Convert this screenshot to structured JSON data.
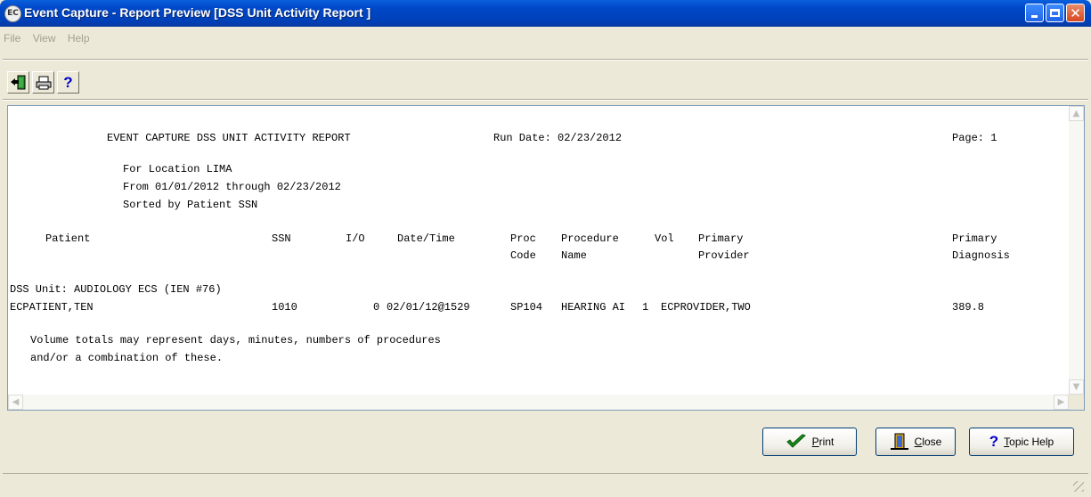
{
  "window": {
    "title": "Event Capture - Report Preview [DSS Unit Activity Report ]",
    "app_icon_text": "EC"
  },
  "menu": [
    "File",
    "View",
    "Help"
  ],
  "toolbar": {
    "exit_icon": "exit-door-icon",
    "print_icon": "printer-icon",
    "help_icon": "question-mark-icon",
    "help_glyph": "?"
  },
  "report": {
    "header": {
      "title": "EVENT CAPTURE DSS UNIT ACTIVITY REPORT",
      "run_date": "Run Date: 02/23/2012",
      "page": "Page: 1"
    },
    "criteria": [
      "For Location LIMA",
      "From 01/01/2012 through 02/23/2012",
      "Sorted by Patient SSN"
    ],
    "columns": {
      "patient": "Patient",
      "ssn": "SSN",
      "io": "I/O",
      "datetime": "Date/Time",
      "proc_code": [
        "Proc",
        "Code"
      ],
      "proc_name": [
        "Procedure",
        "Name"
      ],
      "vol": "Vol",
      "provider": [
        "Primary",
        "Provider"
      ],
      "diagnosis": [
        "Primary",
        "Diagnosis"
      ]
    },
    "unit": "DSS Unit: AUDIOLOGY ECS (IEN #76)",
    "rows": [
      {
        "patient": "ECPATIENT,TEN",
        "ssn": "1010",
        "io": "0",
        "datetime": "02/01/12@1529",
        "proc_code": "SP104",
        "proc_name": "HEARING AI",
        "vol": "1",
        "provider": "ECPROVIDER,TWO",
        "diagnosis": "389.8"
      }
    ],
    "footnote": [
      "Volume totals may represent days, minutes, numbers of procedures",
      "and/or a combination of these."
    ]
  },
  "buttons": {
    "print": "Print",
    "close": "Close",
    "topic_help": "Topic Help"
  },
  "colors": {
    "titlebar": "#0048c8",
    "window_bg": "#ece9d8",
    "report_bg": "#ffffff"
  }
}
